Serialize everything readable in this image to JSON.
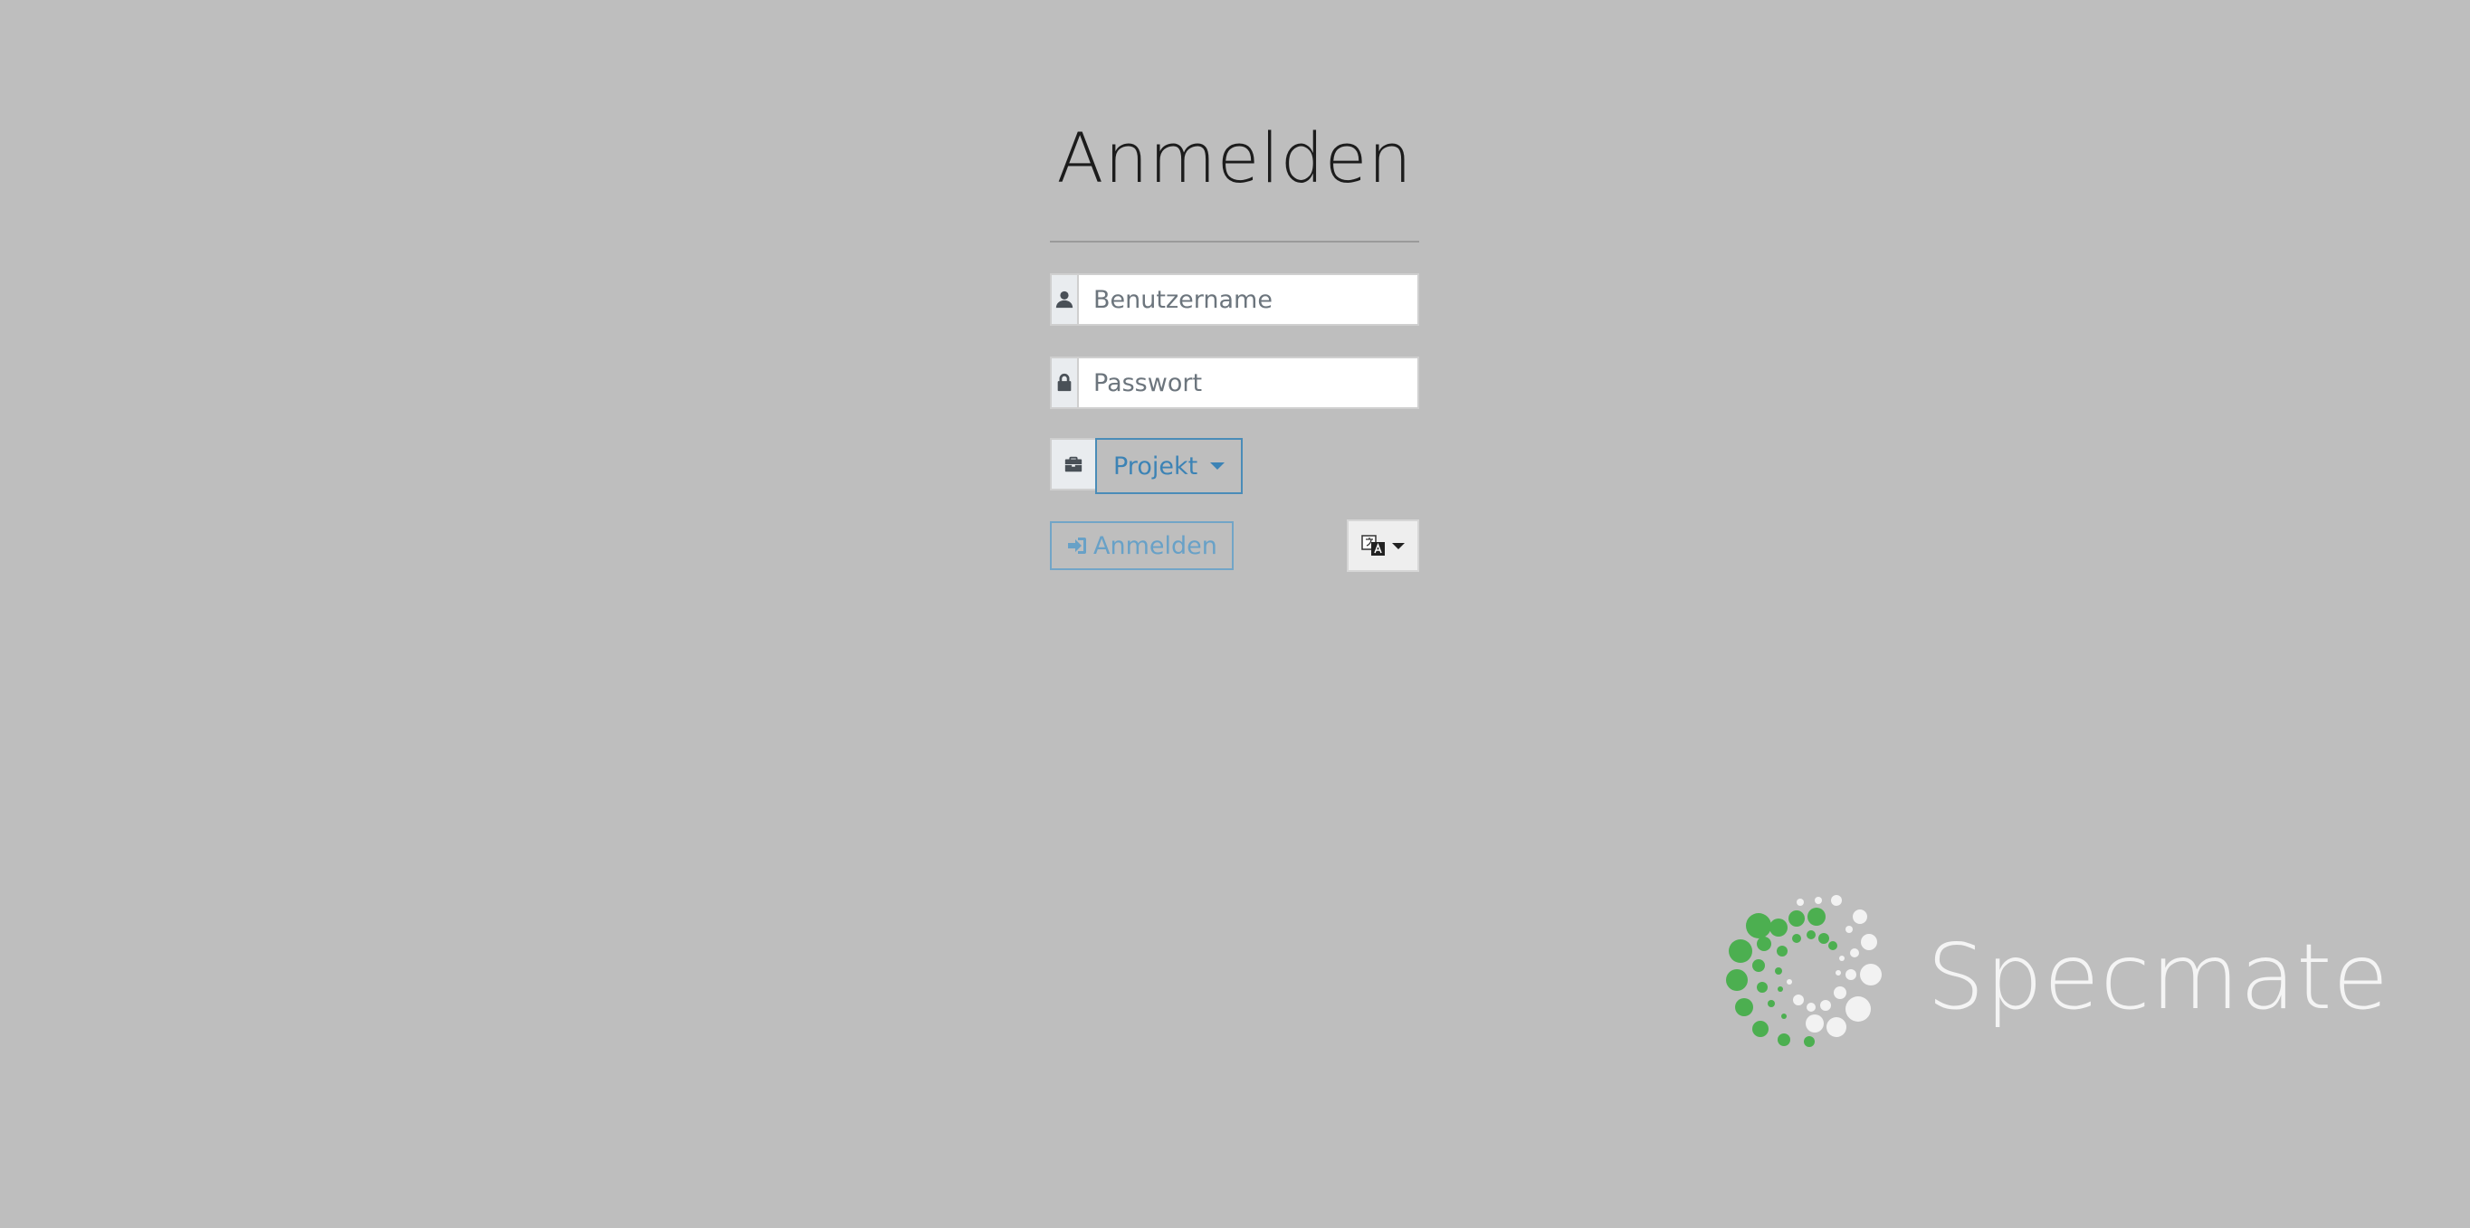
{
  "login": {
    "title": "Anmelden",
    "username_placeholder": "Benutzername",
    "password_placeholder": "Passwort",
    "project_label": "Projekt",
    "submit_label": "Anmelden"
  },
  "icons": {
    "username": "user-icon",
    "password": "lock-icon",
    "project": "briefcase-icon",
    "submit": "sign-in-icon",
    "language": "translate-icon"
  },
  "brand": {
    "name": "Specmate"
  },
  "colors": {
    "background": "#bebebe",
    "accent": "#3c83b5",
    "logo_green": "#4caf50",
    "logo_white": "#f2f2f2"
  }
}
